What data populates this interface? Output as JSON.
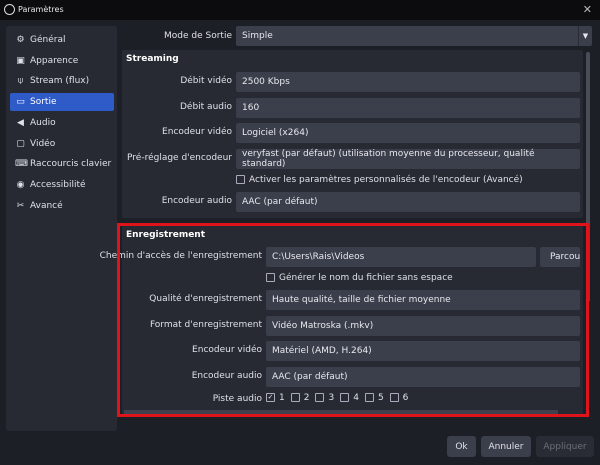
{
  "window": {
    "title": "Paramètres",
    "close": "✕"
  },
  "sidebar": {
    "items": [
      {
        "label": "Général",
        "icon": "gear-icon",
        "glyph": "⚙"
      },
      {
        "label": "Apparence",
        "icon": "appearance-icon",
        "glyph": "▣"
      },
      {
        "label": "Stream (flux)",
        "icon": "antenna-icon",
        "glyph": "⍦"
      },
      {
        "label": "Sortie",
        "icon": "output-icon",
        "glyph": "▭",
        "selected": true
      },
      {
        "label": "Audio",
        "icon": "speaker-icon",
        "glyph": "◀"
      },
      {
        "label": "Vidéo",
        "icon": "monitor-icon",
        "glyph": "▢"
      },
      {
        "label": "Raccourcis clavier",
        "icon": "keyboard-icon",
        "glyph": "⌨"
      },
      {
        "label": "Accessibilité",
        "icon": "accessibility-icon",
        "glyph": "◉"
      },
      {
        "label": "Avancé",
        "icon": "tools-icon",
        "glyph": "✂"
      }
    ]
  },
  "mode": {
    "label": "Mode de Sortie",
    "value": "Simple"
  },
  "streaming": {
    "title": "Streaming",
    "video_bitrate": {
      "label": "Débit vidéo",
      "value": "2500 Kbps"
    },
    "audio_bitrate": {
      "label": "Débit audio",
      "value": "160"
    },
    "video_encoder": {
      "label": "Encodeur vidéo",
      "value": "Logiciel (x264)"
    },
    "preset": {
      "label": "Pré-réglage d'encodeur",
      "value": "veryfast (par défaut) (utilisation moyenne du processeur, qualité standard)"
    },
    "custom": {
      "label": "Activer les paramètres personnalisés de l'encodeur (Avancé)",
      "checked": false
    },
    "audio_encoder": {
      "label": "Encodeur audio",
      "value": "AAC (par défaut)"
    }
  },
  "recording": {
    "title": "Enregistrement",
    "path": {
      "label": "Chemin d'accès de l'enregistrement",
      "value": "C:\\Users\\Rais\\Videos",
      "browse": "Parcourir"
    },
    "nospace": {
      "label": "Générer le nom du fichier sans espace",
      "checked": false
    },
    "quality": {
      "label": "Qualité d'enregistrement",
      "value": "Haute qualité, taille de fichier moyenne"
    },
    "format": {
      "label": "Format d'enregistrement",
      "value": "Vidéo Matroska (.mkv)"
    },
    "video_encoder": {
      "label": "Encodeur vidéo",
      "value": "Matériel (AMD, H.264)"
    },
    "audio_encoder": {
      "label": "Encodeur audio",
      "value": "AAC (par défaut)"
    },
    "tracks": {
      "label": "Piste audio",
      "items": [
        {
          "n": "1",
          "checked": true
        },
        {
          "n": "2",
          "checked": false
        },
        {
          "n": "3",
          "checked": false
        },
        {
          "n": "4",
          "checked": false
        },
        {
          "n": "5",
          "checked": false
        },
        {
          "n": "6",
          "checked": false
        }
      ]
    }
  },
  "buttons": {
    "ok": "Ok",
    "cancel": "Annuler",
    "apply": "Appliquer"
  },
  "colors": {
    "accent": "#2f5bc9",
    "highlight": "#e0121a"
  }
}
